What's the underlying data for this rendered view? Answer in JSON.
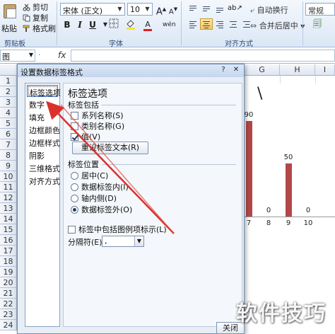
{
  "ribbon": {
    "clipboard": {
      "paste": "粘贴",
      "cut": "剪切",
      "copy": "复制",
      "format_painter": "格式刷",
      "group_label": "剪贴板"
    },
    "font": {
      "name": "宋体 (正文)",
      "size": "10",
      "grow": "A",
      "shrink": "A",
      "bold": "B",
      "italic": "I",
      "underline": "U",
      "font_color": "A",
      "wen": "wén",
      "group_label": "字体"
    },
    "alignment": {
      "wrap_text": "自动换行",
      "merge_center": "合并后居中",
      "group_label": "对齐方式"
    },
    "number": {
      "format": "常规"
    }
  },
  "formula_bar": {
    "fx": "fx"
  },
  "grid": {
    "columns": [
      "G",
      "H",
      "I"
    ],
    "rows": [
      "1",
      "2",
      "3",
      "4",
      "5",
      "6",
      "7",
      "8",
      "9",
      "10",
      "11",
      "12",
      "13",
      "14",
      "15",
      "16",
      "17",
      "18",
      "19",
      "20",
      "21",
      "22",
      "23",
      "24"
    ]
  },
  "chart_data": {
    "type": "bar",
    "categories": [
      "7",
      "8",
      "9",
      "10"
    ],
    "values": [
      90,
      0,
      50,
      0
    ],
    "data_labels": [
      "90",
      "0",
      "50",
      "0"
    ],
    "title_fragment": "\\",
    "color": "#b24848"
  },
  "dialog": {
    "title": "设置数据标签格式",
    "controls": {
      "help": "?",
      "close": "✕"
    },
    "nav": [
      "标签选项",
      "数字",
      "填充",
      "边框颜色",
      "边框样式",
      "阴影",
      "三维格式",
      "对齐方式"
    ],
    "heading": "标签选项",
    "contains_label": "标签包括",
    "checkboxes": [
      {
        "label": "系列名称(S)",
        "checked": false
      },
      {
        "label": "类别名称(G)",
        "checked": false
      },
      {
        "label": "值(V)",
        "checked": true
      }
    ],
    "reset_button": "重设标签文本(R)",
    "position_label": "标签位置",
    "radios": [
      {
        "label": "居中(C)",
        "checked": false
      },
      {
        "label": "数据标签内(I)",
        "checked": false
      },
      {
        "label": "轴内侧(D)",
        "checked": false
      },
      {
        "label": "数据标签外(O)",
        "checked": true
      }
    ],
    "legend_key": "标签中包括图例项标示(L)",
    "separator_label": "分隔符(E)",
    "separator_value": ",",
    "close_button": "关闭"
  },
  "watermark": "软件技巧"
}
